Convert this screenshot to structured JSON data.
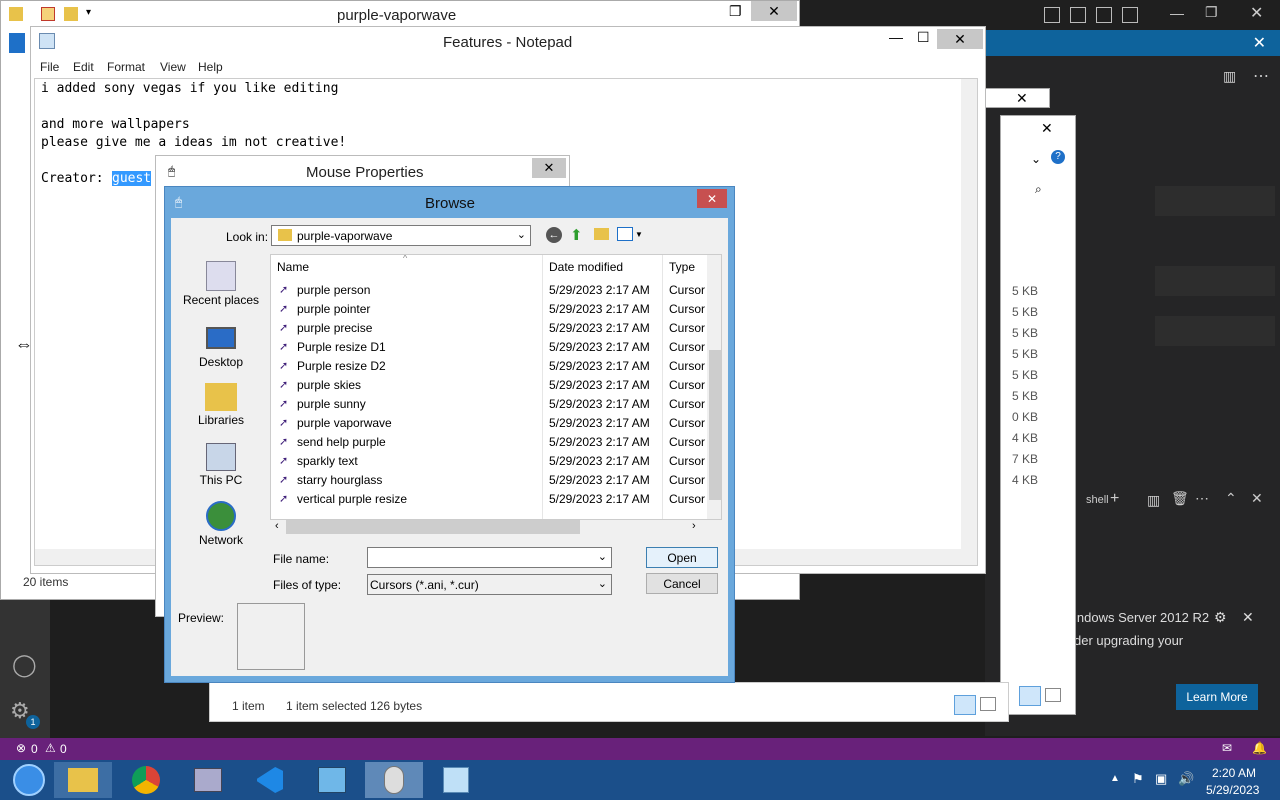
{
  "explorer": {
    "title": "purple-vaporwave",
    "status_items": "20 items",
    "status_count": "1 item",
    "status_selected": "1 item selected  126 bytes",
    "sizes": [
      "5 KB",
      "5 KB",
      "5 KB",
      "5 KB",
      "5 KB",
      "5 KB",
      "0 KB",
      "4 KB",
      "7 KB",
      "4 KB"
    ]
  },
  "notepad": {
    "title": "Features - Notepad",
    "menu": [
      "File",
      "Edit",
      "Format",
      "View",
      "Help"
    ],
    "lines": [
      "i added sony vegas if you like editing",
      "",
      "and more wallpapers",
      "please give me a ideas im not creative!",
      "",
      "Creator: "
    ],
    "selected": "guest"
  },
  "mouse_props": {
    "title": "Mouse Properties"
  },
  "browse": {
    "title": "Browse",
    "look_in_label": "Look in:",
    "look_in_value": "purple-vaporwave",
    "places": [
      "Recent places",
      "Desktop",
      "Libraries",
      "This PC",
      "Network"
    ],
    "columns": [
      "Name",
      "Date modified",
      "Type"
    ],
    "files": [
      {
        "name": "purple person",
        "date": "5/29/2023 2:17 AM",
        "type": "Cursor"
      },
      {
        "name": "purple pointer",
        "date": "5/29/2023 2:17 AM",
        "type": "Cursor"
      },
      {
        "name": "purple precise",
        "date": "5/29/2023 2:17 AM",
        "type": "Cursor"
      },
      {
        "name": "Purple resize D1",
        "date": "5/29/2023 2:17 AM",
        "type": "Cursor"
      },
      {
        "name": "Purple resize D2",
        "date": "5/29/2023 2:17 AM",
        "type": "Cursor"
      },
      {
        "name": "purple skies",
        "date": "5/29/2023 2:17 AM",
        "type": "Cursor"
      },
      {
        "name": "purple sunny",
        "date": "5/29/2023 2:17 AM",
        "type": "Cursor"
      },
      {
        "name": "purple vaporwave",
        "date": "5/29/2023 2:17 AM",
        "type": "Cursor"
      },
      {
        "name": "send help purple",
        "date": "5/29/2023 2:17 AM",
        "type": "Cursor"
      },
      {
        "name": "sparkly text",
        "date": "5/29/2023 2:17 AM",
        "type": "Cursor"
      },
      {
        "name": "starry hourglass",
        "date": "5/29/2023 2:17 AM",
        "type": "Cursor"
      },
      {
        "name": "vertical purple resize",
        "date": "5/29/2023 2:17 AM",
        "type": "Cursor"
      }
    ],
    "file_name_label": "File name:",
    "file_name_value": "",
    "files_of_type_label": "Files of type:",
    "files_of_type_value": "Cursors (*.ani, *.cur)",
    "open_label": "Open",
    "cancel_label": "Cancel",
    "preview_label": "Preview:"
  },
  "vscode": {
    "terminal_label": "shell",
    "notif_line1": "indows Server 2012 R2",
    "notif_line2": "der upgrading your",
    "learn_more": "Learn More",
    "status_errors": "0",
    "status_warnings": "0",
    "badge": "1"
  },
  "taskbar": {
    "time": "2:20 AM",
    "date": "5/29/2023"
  },
  "colors": {
    "accent": "#68217a",
    "taskbar": "#1b4f8a",
    "dialog_frame": "#6aa8dc",
    "vscode_blue": "#0e639c"
  }
}
